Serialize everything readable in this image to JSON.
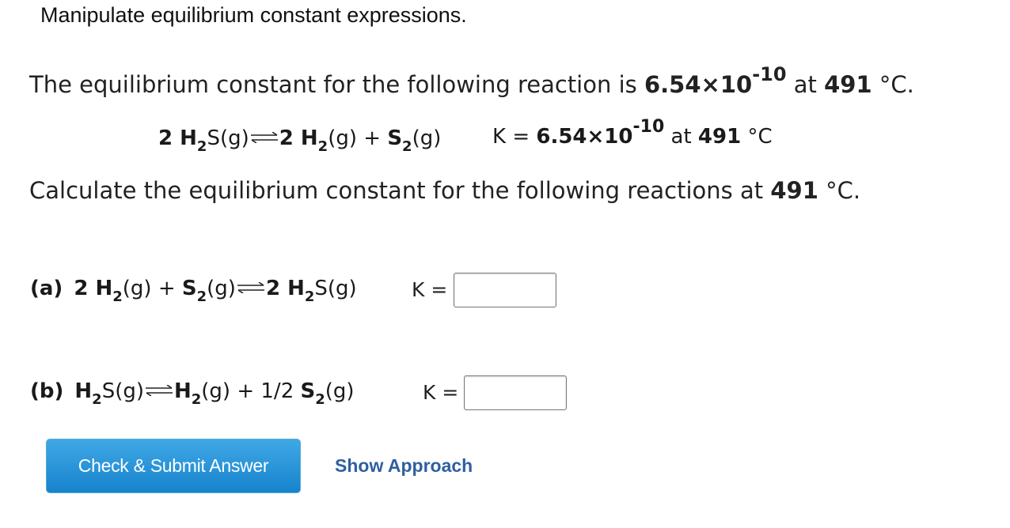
{
  "title": "Manipulate equilibrium constant expressions.",
  "intro": {
    "prefix": "The equilibrium constant for the following reaction is ",
    "k_mantissa": "6.54×10",
    "k_exponent": "-10",
    "at": " at ",
    "temp": "491",
    "unit": " °C."
  },
  "reaction_main": {
    "lhs_coef": "2 ",
    "lhs_species": "H",
    "lhs_sub": "2",
    "lhs_rest": "S(g)",
    "rhs1_coef": "2 ",
    "rhs1_species": "H",
    "rhs1_sub": "2",
    "rhs1_rest": "(g) + ",
    "rhs2_species": "S",
    "rhs2_sub": "2",
    "rhs2_rest": "(g)",
    "k_prefix": "K = ",
    "k_mantissa": "6.54×10",
    "k_exponent": "-10",
    "at": " at ",
    "temp": "491",
    "unit": " °C"
  },
  "calc": {
    "prefix": "Calculate the equilibrium constant for the following reactions at ",
    "temp": "491",
    "unit": " °C."
  },
  "part_a": {
    "label": "(a)",
    "lhs1_coef": "2 ",
    "lhs1_species": "H",
    "lhs1_sub": "2",
    "lhs1_rest": "(g) + ",
    "lhs2_species": "S",
    "lhs2_sub": "2",
    "lhs2_rest": "(g)",
    "rhs_coef": "2 ",
    "rhs_species": "H",
    "rhs_sub": "2",
    "rhs_rest": "S(g)",
    "k_label": "K =",
    "k_value": ""
  },
  "part_b": {
    "label": "(b)",
    "lhs_species": "H",
    "lhs_sub": "2",
    "lhs_rest": "S(g)",
    "rhs1_species": "H",
    "rhs1_sub": "2",
    "rhs1_rest": "(g) + 1/2 ",
    "rhs2_species": "S",
    "rhs2_sub": "2",
    "rhs2_rest": "(g)",
    "k_label": "K =",
    "k_value": ""
  },
  "buttons": {
    "submit": "Check & Submit Answer",
    "approach": "Show Approach"
  },
  "colors": {
    "button_top": "#3fa8e6",
    "button_bottom": "#1783cc",
    "link": "#2f5fa0"
  }
}
